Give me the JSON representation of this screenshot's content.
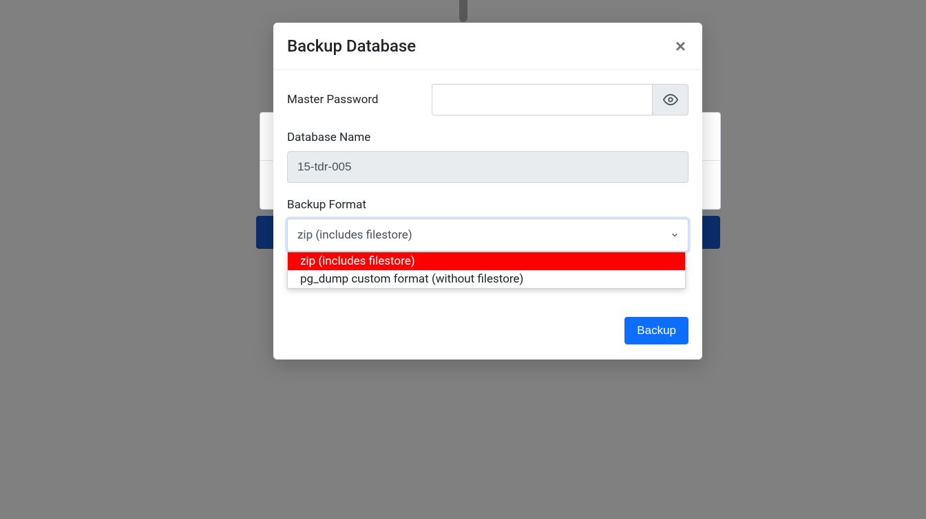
{
  "modal": {
    "title": "Backup Database",
    "master_password_label": "Master Password",
    "master_password_value": "",
    "database_name_label": "Database Name",
    "database_name_value": "15-tdr-005",
    "backup_format_label": "Backup Format",
    "backup_format_selected": "zip (includes filestore)",
    "backup_format_options": [
      "zip (includes filestore)",
      "pg_dump custom format (without filestore)"
    ],
    "backup_button_label": "Backup"
  },
  "icons": {
    "close": "×",
    "eye": "eye-icon",
    "chevron": "chevron-down-icon"
  },
  "colors": {
    "primary": "#0d6efd",
    "highlight": "#ff0000",
    "dark_bar": "#0b2e6b"
  }
}
